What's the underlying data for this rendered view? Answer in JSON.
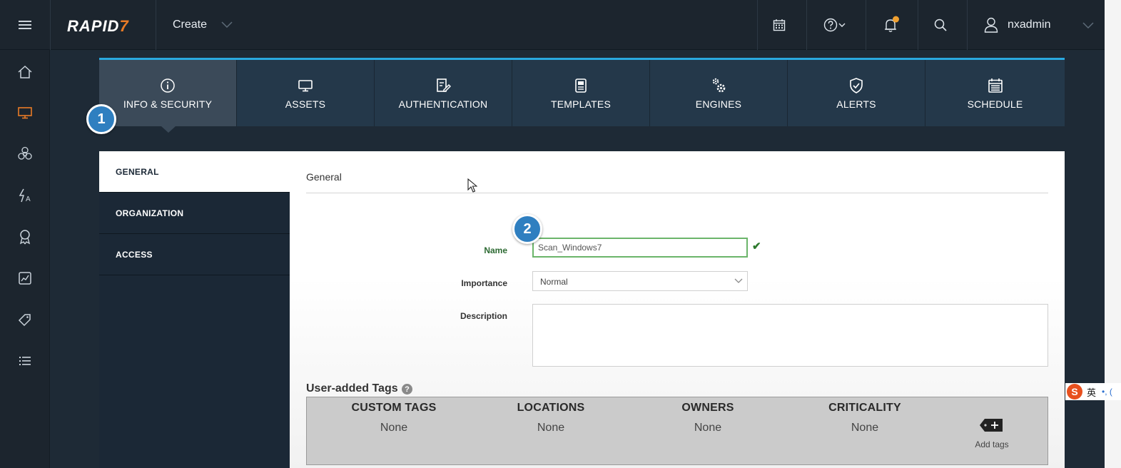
{
  "topbar": {
    "brand_main": "RAPID",
    "brand_accent": "7",
    "create_label": "Create",
    "username": "nxadmin",
    "icons": [
      "menu-icon",
      "calendar-icon",
      "help-icon",
      "bell-icon",
      "search-icon",
      "user-icon",
      "chevron-down-icon"
    ]
  },
  "leftnav": {
    "items": [
      {
        "icon": "home-icon",
        "active": false
      },
      {
        "icon": "monitor-icon",
        "active": true
      },
      {
        "icon": "biohazard-icon",
        "active": false
      },
      {
        "icon": "policy-icon",
        "active": false
      },
      {
        "icon": "award-icon",
        "active": false
      },
      {
        "icon": "report-chart-icon",
        "active": false
      },
      {
        "icon": "tag-icon",
        "active": false
      },
      {
        "icon": "list-icon",
        "active": false
      }
    ]
  },
  "tabs": [
    {
      "label": "INFO & SECURITY",
      "icon": "info-icon",
      "active": true
    },
    {
      "label": "ASSETS",
      "icon": "monitor-icon",
      "active": false
    },
    {
      "label": "AUTHENTICATION",
      "icon": "edit-doc-icon",
      "active": false
    },
    {
      "label": "TEMPLATES",
      "icon": "template-icon",
      "active": false
    },
    {
      "label": "ENGINES",
      "icon": "gears-icon",
      "active": false
    },
    {
      "label": "ALERTS",
      "icon": "shield-check-icon",
      "active": false
    },
    {
      "label": "SCHEDULE",
      "icon": "calendar-icon",
      "active": false
    }
  ],
  "badges": {
    "one": "1",
    "two": "2"
  },
  "subnav": [
    {
      "label": "GENERAL",
      "active": true
    },
    {
      "label": "ORGANIZATION",
      "active": false
    },
    {
      "label": "ACCESS",
      "active": false
    }
  ],
  "form": {
    "section_title": "General",
    "name_label": "Name",
    "name_value": "Scan_Windows7",
    "importance_label": "Importance",
    "importance_value": "Normal",
    "description_label": "Description",
    "description_value": ""
  },
  "tags": {
    "title": "User-added Tags",
    "help_glyph": "?",
    "columns": [
      {
        "header": "CUSTOM TAGS",
        "value": "None"
      },
      {
        "header": "LOCATIONS",
        "value": "None"
      },
      {
        "header": "OWNERS",
        "value": "None"
      },
      {
        "header": "CRITICALITY",
        "value": "None"
      }
    ],
    "add_label": "Add tags"
  },
  "ime": {
    "logo": "S",
    "lang": "英",
    "rest": "•, ("
  },
  "colors": {
    "accent_blue": "#2aa9e0",
    "brand_orange": "#e87b26",
    "badge_blue": "#2f7fc0",
    "valid_green": "#2d7a2d"
  }
}
